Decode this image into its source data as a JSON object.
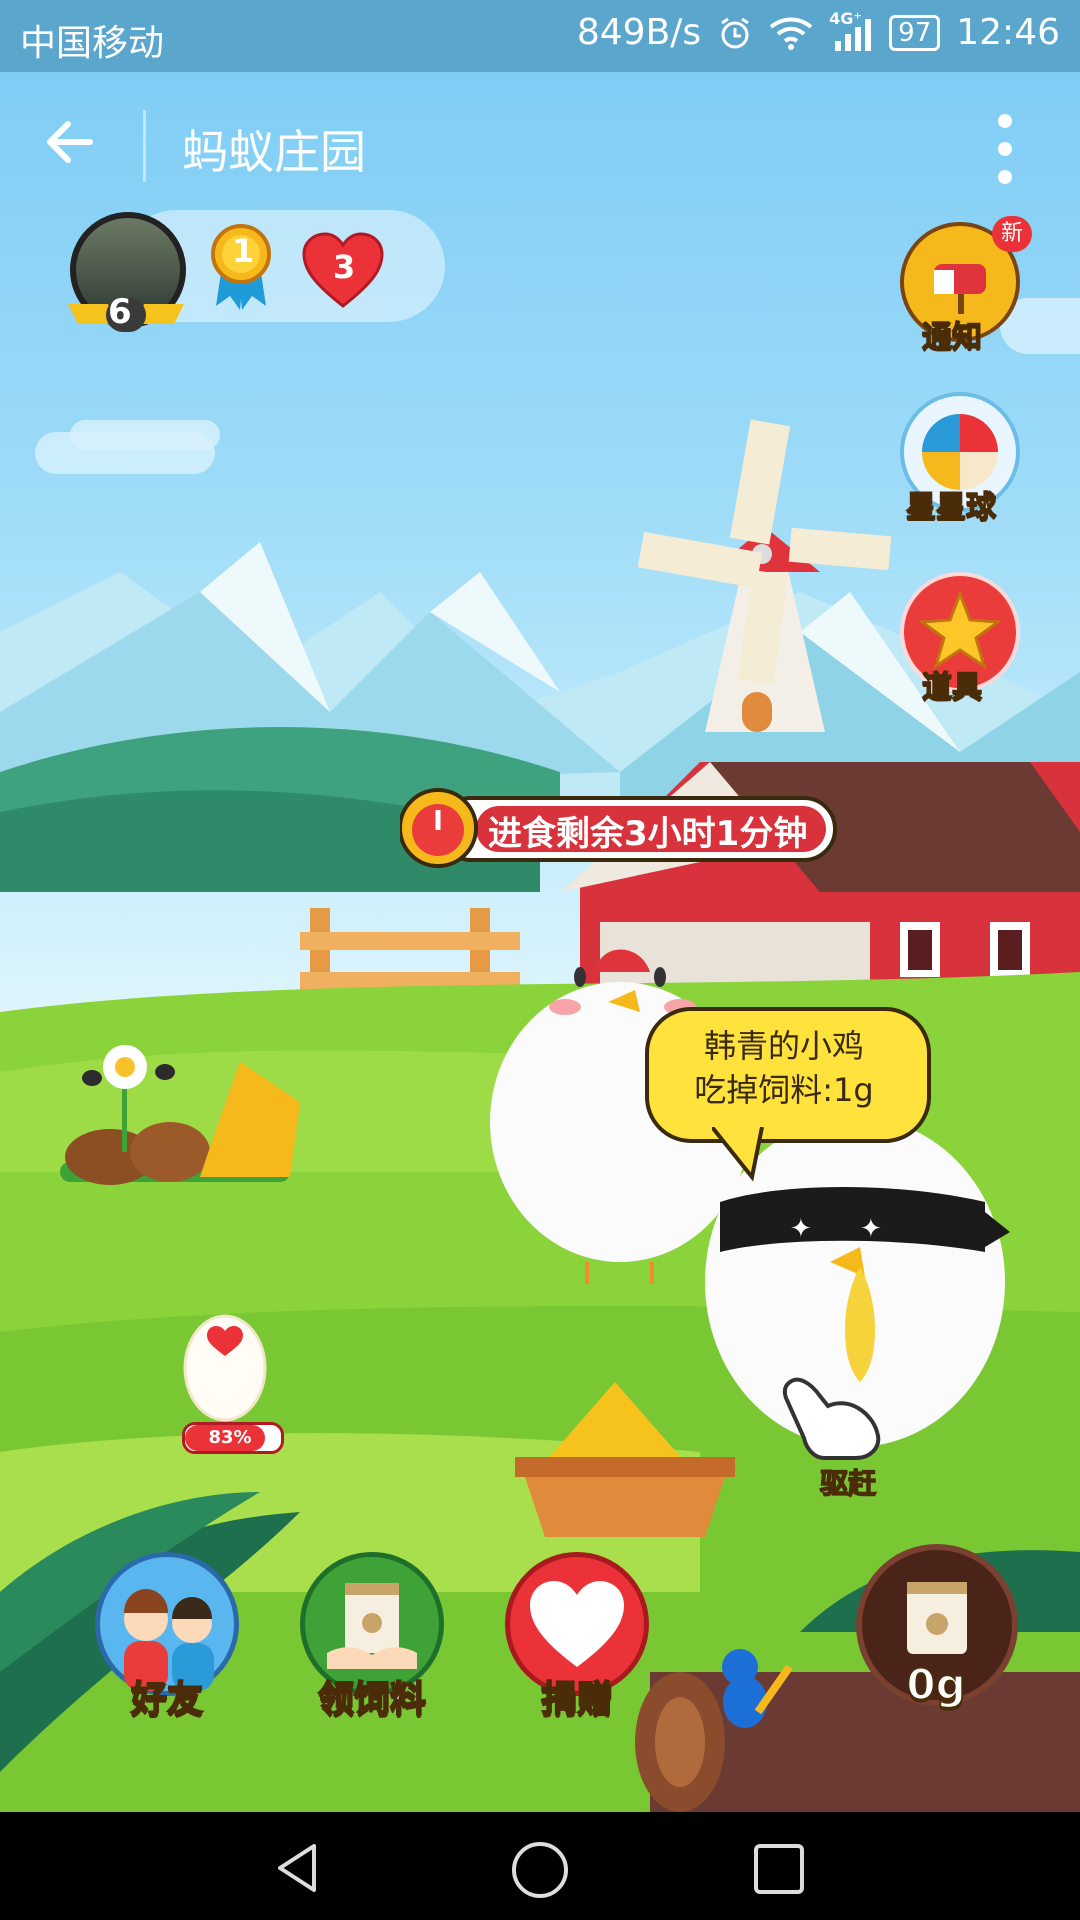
{
  "status_bar": {
    "carrier": "中国移动",
    "speed": "849B/s",
    "network": "4G⁺",
    "battery": "97",
    "time": "12:46"
  },
  "header": {
    "title": "蚂蚁庄园"
  },
  "user": {
    "level": "6",
    "medal_rank": "1",
    "hearts": "3"
  },
  "side_buttons": [
    {
      "label": "通知",
      "badge": "新",
      "icon": "mailbox-icon"
    },
    {
      "label": "星星球",
      "icon": "beach-ball-icon"
    },
    {
      "label": "道具",
      "icon": "star-icon"
    }
  ],
  "timer": {
    "text": "进食剩余3小时1分钟"
  },
  "speech_bubble": {
    "line1": "韩青的小鸡",
    "line2": "吃掉饲料:1g"
  },
  "egg": {
    "progress_text": "83%",
    "progress": 0.83
  },
  "drive_away": {
    "label": "驱赶"
  },
  "bottom_buttons": [
    {
      "label": "好友",
      "icon": "friends-icon"
    },
    {
      "label": "领饲料",
      "icon": "feed-bag-icon"
    },
    {
      "label": "捐赠",
      "icon": "donate-heart-icon"
    }
  ],
  "feed": {
    "amount": "0g"
  },
  "colors": {
    "sky": "#7fcdf5",
    "grass": "#8bd33a",
    "barn_red": "#d8323c",
    "gold": "#f6b91c"
  }
}
